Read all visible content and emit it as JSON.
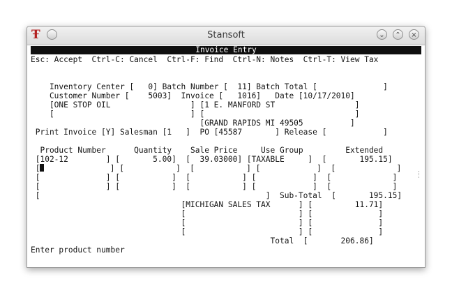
{
  "window": {
    "title": "Stansoft",
    "app_icon_glyph": "Ŧ"
  },
  "header": {
    "title": "Invoice Entry"
  },
  "keys": "Esc: Accept  Ctrl-C: Cancel  Ctrl-F: Find  Ctrl-N: Notes  Ctrl-T: View Tax",
  "form": {
    "line1": "    Inventory Center [   0] Batch Number [  11] Batch Total [              ]",
    "line2": "    Customer Number [    5003]  Invoice [   1016]   Date [10/17/2010]",
    "line3": "    [ONE STOP OIL                 ] [1 E. MANFORD ST                 ]",
    "line4": "    [                             ] [                                ]",
    "line5": "                                    [GRAND RAPIDS MI 49505          ]",
    "line6": " Print Invoice [Y] Salesman [1   ]  PO [45587       ] Release [            ]"
  },
  "table": {
    "header": "  Product Number      Quantity    Sale Price     Use Group         Extended",
    "row1": " [102-12        ] [       5.00]  [  39.03000] [TAXABLE     ]  [       195.15]",
    "row2a": " [",
    "row2b": "              ] [           ]  [           ] [            ]  [             ]",
    "row3": " [              ] [           ]  [           ] [            ]  [             ]",
    "row4": " [              ] [           ]  [           ] [            ]  [             ]",
    "row5": " [                                                ]  Sub-Total  [       195.15]",
    "tax1": "                                [MICHIGAN SALES TAX      ] [         11.71]",
    "tax2": "                                [                        ] [              ]",
    "tax3": "                                [                        ] [              ]",
    "tax4": "                                [                        ] [              ]",
    "total": "                                                   Total  [       206.86]"
  },
  "status": "Enter product number"
}
